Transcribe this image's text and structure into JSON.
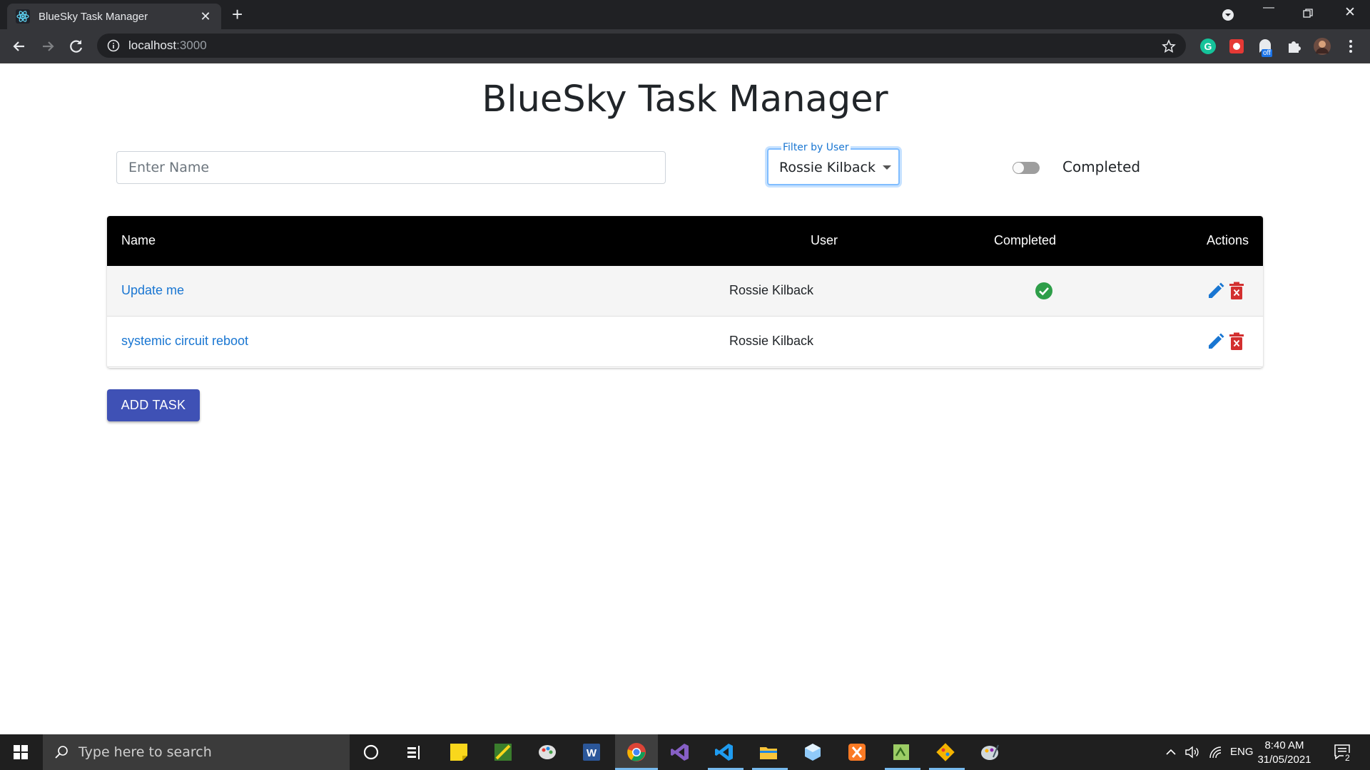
{
  "browser": {
    "tab_title": "BlueSky Task Manager",
    "url_host": "localhost",
    "url_port": ":3000",
    "extension_badge": "off"
  },
  "page": {
    "title": "BlueSky Task Manager",
    "name_input_placeholder": "Enter Name",
    "filter_label": "Filter by User",
    "filter_value": "Rossie Kilback",
    "completed_toggle_label": "Completed",
    "completed_toggle_on": false,
    "add_button_label": "ADD TASK"
  },
  "table": {
    "headers": {
      "name": "Name",
      "user": "User",
      "completed": "Completed",
      "actions": "Actions"
    },
    "rows": [
      {
        "name": "Update me",
        "user": "Rossie Kilback",
        "completed": true
      },
      {
        "name": "systemic circuit reboot",
        "user": "Rossie Kilback",
        "completed": false
      }
    ]
  },
  "taskbar": {
    "search_placeholder": "Type here to search",
    "language": "ENG",
    "time": "8:40 AM",
    "date": "31/05/2021",
    "notification_count": "2"
  },
  "colors": {
    "link": "#1976d2",
    "primary_button": "#3f51b5",
    "completed_check": "#2e9e49",
    "delete": "#d32f2f",
    "table_header_bg": "#000000"
  }
}
